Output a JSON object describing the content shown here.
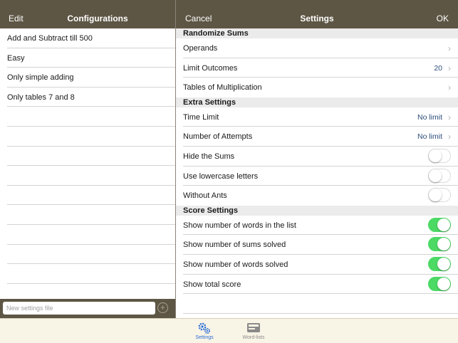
{
  "left_pane": {
    "edit_label": "Edit",
    "title": "Configurations",
    "items": [
      {
        "label": "Add and Subtract till 500"
      },
      {
        "label": "Easy"
      },
      {
        "label": "Only simple adding"
      },
      {
        "label": "Only tables 7 and 8"
      }
    ],
    "new_file_placeholder": "New settings file",
    "add_icon": "plus-circle-icon"
  },
  "right_pane": {
    "cancel_label": "Cancel",
    "title": "Settings",
    "ok_label": "OK",
    "sections": {
      "randomize": {
        "title": "Randomize Sums",
        "operands": {
          "label": "Operands"
        },
        "limit_outcomes": {
          "label": "Limit Outcomes",
          "value": "20"
        },
        "tables": {
          "label": "Tables of Multiplication"
        }
      },
      "extra": {
        "title": "Extra Settings",
        "time_limit": {
          "label": "Time Limit",
          "value": "No limit"
        },
        "attempts": {
          "label": "Number of Attempts",
          "value": "No limit"
        },
        "hide_sums": {
          "label": "Hide the Sums",
          "on": false
        },
        "lowercase": {
          "label": "Use lowercase letters",
          "on": false
        },
        "without_ants": {
          "label": "Without Ants",
          "on": false
        }
      },
      "score": {
        "title": "Score Settings",
        "words_in_list": {
          "label": "Show number of words in the list",
          "on": true
        },
        "sums_solved": {
          "label": "Show number of sums solved",
          "on": true
        },
        "words_solved": {
          "label": "Show number of words solved",
          "on": true
        },
        "total_score": {
          "label": "Show total score",
          "on": true
        }
      }
    },
    "colors": {
      "toggle_on": "#4cd964",
      "header": "#5e5645",
      "value_text": "#2c4d7a"
    }
  },
  "tabbar": {
    "settings": {
      "label": "Settings",
      "icon": "gears-icon",
      "active": true
    },
    "wordlists": {
      "label": "Word-lists",
      "icon": "word-lists-icon",
      "active": false
    }
  }
}
